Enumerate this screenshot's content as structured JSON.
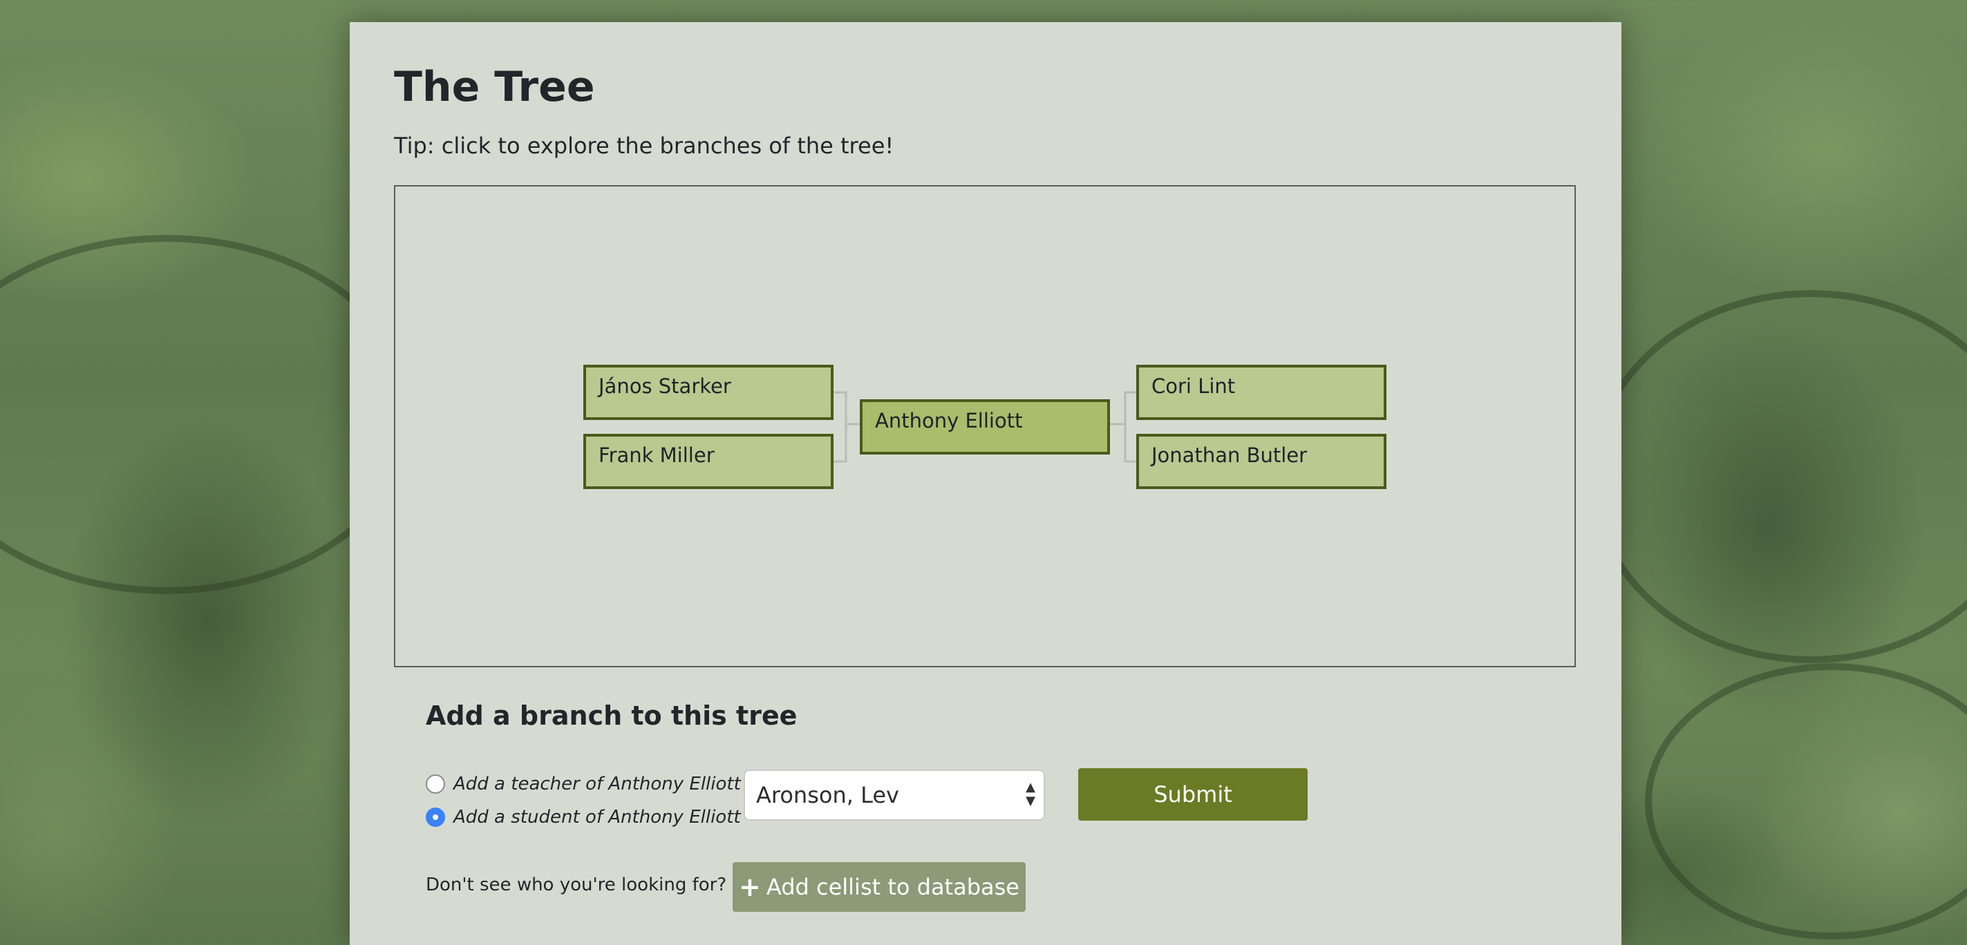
{
  "page": {
    "title": "The Tree",
    "tip": "Tip: click to explore the branches of the tree!"
  },
  "tree": {
    "teachers": [
      "János Starker",
      "Frank Miller"
    ],
    "center": "Anthony Elliott",
    "students": [
      "Cori Lint",
      "Jonathan Butler"
    ]
  },
  "add_branch": {
    "heading": "Add a branch to this tree",
    "options": [
      {
        "label": "Add a teacher of Anthony Elliott",
        "checked": false
      },
      {
        "label": "Add a student of Anthony Elliott",
        "checked": true
      }
    ],
    "select_value": "Aronson, Lev",
    "submit_label": "Submit"
  },
  "footer": {
    "not_found_text": "Don't see who you're looking for?",
    "add_cellist_label": "Add cellist to database",
    "add_icon": "plus-icon"
  },
  "colors": {
    "node_fill": "#b9c98f",
    "node_center_fill": "#a9bd6c",
    "node_border": "#4a5a1a",
    "submit_bg": "#6b7a24",
    "add_cellist_bg": "#8c9a78",
    "radio_checked": "#3b82f6"
  }
}
